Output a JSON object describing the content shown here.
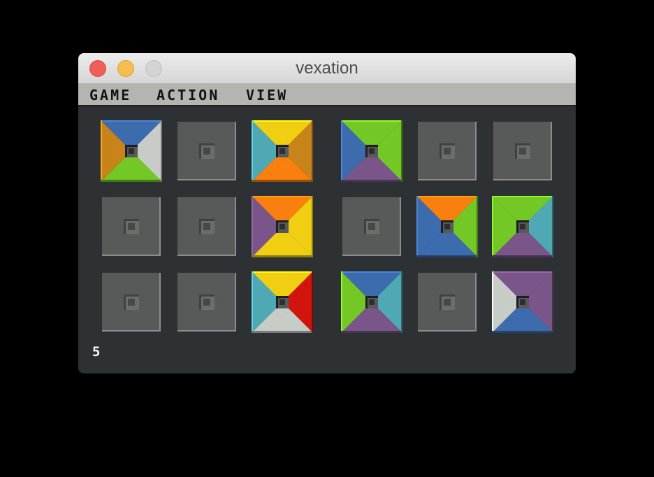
{
  "window": {
    "title": "vexation",
    "controls": [
      "close-button",
      "minimize-button",
      "zoom-button"
    ]
  },
  "menu": {
    "items": [
      "GAME",
      "ACTION",
      "VIEW"
    ]
  },
  "status": {
    "value": "5"
  },
  "colors": {
    "window_bg": "#2e3134",
    "empty_tile": "#585a59",
    "blue": "#3d6cae",
    "orange_brown": "#c88418",
    "light_gray": "#c7ccc6",
    "green": "#74c825",
    "yellow": "#f0cf12",
    "cyan": "#4ea9b5",
    "orange": "#f9800f",
    "purple": "#7a5589",
    "red": "#d1140e"
  },
  "board": {
    "columns": 6,
    "rows": 3,
    "tiles": [
      [
        {
          "placed": true,
          "top": "blue",
          "right": "light_gray",
          "bottom": "green",
          "left": "orange_brown"
        },
        {
          "placed": false
        },
        {
          "placed": true,
          "top": "yellow",
          "right": "orange_brown",
          "bottom": "orange",
          "left": "cyan"
        },
        {
          "placed": true,
          "top": "green",
          "right": "green",
          "bottom": "purple",
          "left": "blue"
        },
        {
          "placed": false
        },
        {
          "placed": false
        }
      ],
      [
        {
          "placed": false
        },
        {
          "placed": false
        },
        {
          "placed": true,
          "top": "orange",
          "right": "yellow",
          "bottom": "yellow",
          "left": "purple"
        },
        {
          "placed": false
        },
        {
          "placed": true,
          "top": "orange",
          "right": "green",
          "bottom": "blue",
          "left": "blue"
        },
        {
          "placed": true,
          "top": "green",
          "right": "cyan",
          "bottom": "purple",
          "left": "green"
        }
      ],
      [
        {
          "placed": false
        },
        {
          "placed": false
        },
        {
          "placed": true,
          "top": "yellow",
          "right": "red",
          "bottom": "light_gray",
          "left": "cyan"
        },
        {
          "placed": true,
          "top": "blue",
          "right": "cyan",
          "bottom": "purple",
          "left": "green"
        },
        {
          "placed": false
        },
        {
          "placed": true,
          "top": "purple",
          "right": "purple",
          "bottom": "blue",
          "left": "light_gray"
        }
      ]
    ]
  }
}
